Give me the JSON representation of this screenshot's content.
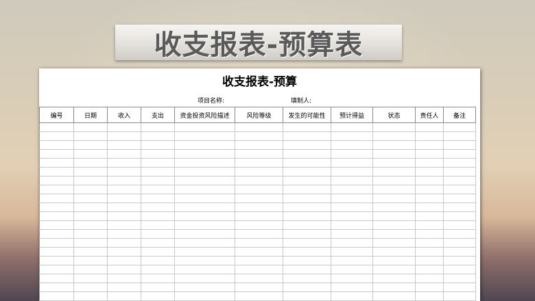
{
  "banner": {
    "title": "收支报表-预算表"
  },
  "sheet": {
    "title": "收支报表-预算",
    "project_label": "项目名称:",
    "maker_label": "填制人:",
    "columns": [
      "编号",
      "日期",
      "收入",
      "支出",
      "资金投资风险描述",
      "风险等级",
      "发生的可能性",
      "预计得益",
      "状态",
      "责任人",
      "备注"
    ],
    "empty_row_count": 21
  }
}
